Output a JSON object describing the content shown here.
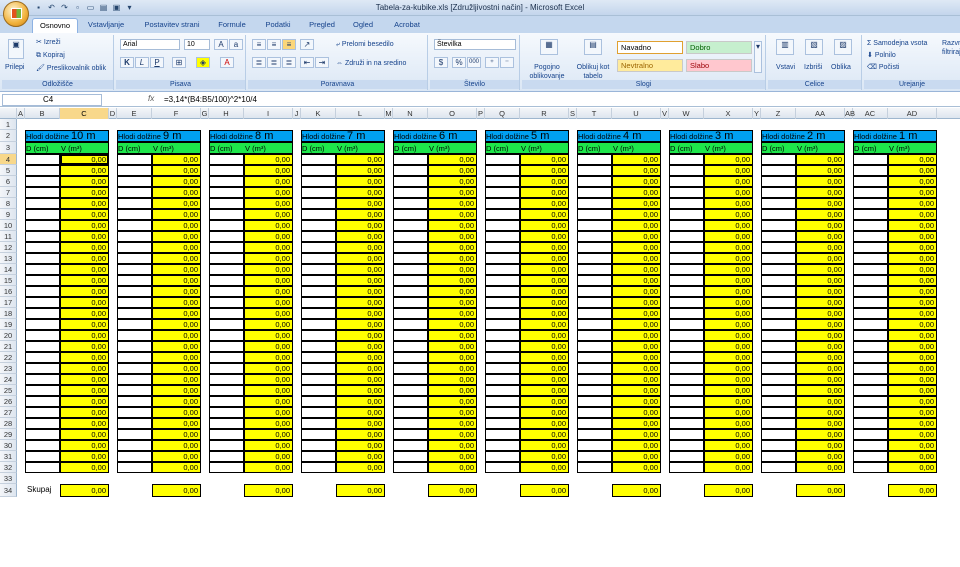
{
  "window_title": "Tabela-za-kubike.xls  [Združljivostni način]  -  Microsoft Excel",
  "tabs": [
    "Osnovno",
    "Vstavljanje",
    "Postavitev strani",
    "Formule",
    "Podatki",
    "Pregled",
    "Ogled",
    "Acrobat"
  ],
  "ribbon": {
    "clipboard": {
      "paste": "Prilepi",
      "cut": "Izreži",
      "copy": "Kopiraj",
      "format_painter": "Preslikovalnik oblik",
      "label": "Odložišče"
    },
    "font": {
      "name": "Arial",
      "size": "10",
      "bold": "K",
      "italic": "L",
      "underline": "P",
      "label": "Pisava"
    },
    "alignment": {
      "wrap": "Prelomi besedilo",
      "merge": "Združi in na sredino",
      "label": "Poravnava"
    },
    "number": {
      "format": "Številka",
      "percent": "%",
      "thousands": "000",
      "label": "Število"
    },
    "styles": {
      "conditional": "Pogojno oblikovanje",
      "as_table": "Oblikuj kot tabelo",
      "normal": "Navadno",
      "good": "Dobro",
      "neutral": "Nevtralno",
      "bad": "Slabo",
      "label": "Slogi"
    },
    "cells": {
      "insert": "Vstavi",
      "delete": "Izbriši",
      "format": "Oblika",
      "label": "Celice"
    },
    "editing": {
      "autosum": "Samodejna vsota",
      "fill": "Polnilo",
      "clear": "Počisti",
      "sort": "Razvrsti in filtriraj",
      "label": "Urejanje"
    }
  },
  "formula_bar": {
    "name_box": "C4",
    "fx": "fx",
    "formula": "=3,14*(B4:B5/100)^2*10/4"
  },
  "columns": [
    "A",
    "B",
    "C",
    "D",
    "E",
    "F",
    "G",
    "H",
    "I",
    "J",
    "K",
    "L",
    "M",
    "N",
    "O",
    "P",
    "Q",
    "R",
    "S",
    "T",
    "U",
    "V",
    "W",
    "X",
    "Y",
    "Z",
    "AA",
    "AB",
    "AC",
    "AD"
  ],
  "rows": [
    1,
    2,
    3,
    4,
    5,
    6,
    7,
    8,
    9,
    10,
    11,
    12,
    13,
    14,
    15,
    16,
    17,
    18,
    19,
    20,
    21,
    22,
    23,
    24,
    25,
    26,
    27,
    28,
    29,
    30,
    31,
    32,
    33,
    34
  ],
  "table_header_prefix": "Hlodi dolžine",
  "lengths": [
    "10 m",
    "9 m",
    "8 m",
    "7 m",
    "6 m",
    "5 m",
    "4 m",
    "3 m",
    "2 m",
    "1 m"
  ],
  "sub_headers": {
    "d": "D (cm)",
    "v": "V (m³)"
  },
  "cell_value": "0,00",
  "sum_label": "Skupaj",
  "sum_value": "0,00"
}
